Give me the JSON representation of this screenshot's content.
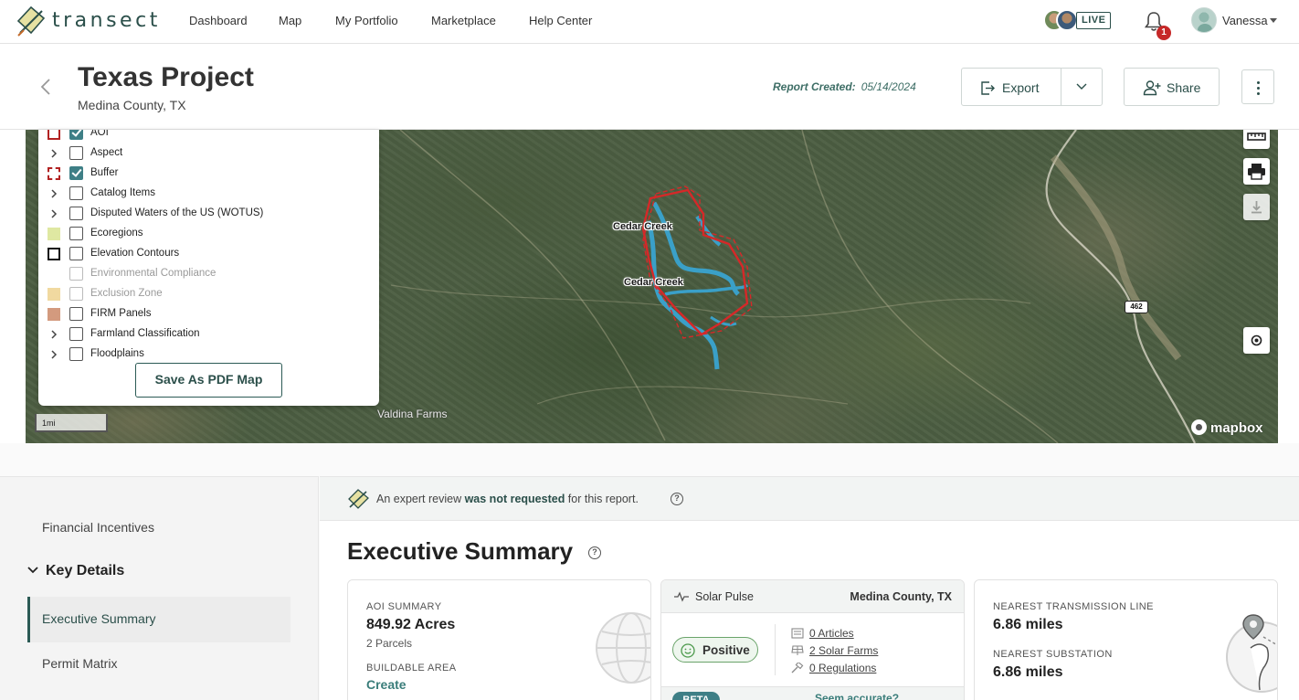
{
  "nav": {
    "brand": "transect",
    "links": [
      "Dashboard",
      "Map",
      "My Portfolio",
      "Marketplace",
      "Help Center"
    ],
    "live_label": "LIVE",
    "notification_count": "1",
    "user_name": "Vanessa"
  },
  "header": {
    "title": "Texas Project",
    "subtitle": "Medina County, TX",
    "report_created_label": "Report Created:",
    "report_created_date": "05/14/2024",
    "export_label": "Export",
    "share_label": "Share"
  },
  "layers": {
    "items": [
      {
        "label": "AOI",
        "checked": true,
        "marker": "aoi-swatch"
      },
      {
        "label": "Aspect",
        "checked": false,
        "marker": "chevron"
      },
      {
        "label": "Buffer",
        "checked": true,
        "marker": "buffer-swatch"
      },
      {
        "label": "Catalog Items",
        "checked": false,
        "marker": "chevron"
      },
      {
        "label": "Disputed Waters of the US (WOTUS)",
        "checked": false,
        "marker": "chevron"
      },
      {
        "label": "Ecoregions",
        "checked": false,
        "marker": "ecoregion-swatch"
      },
      {
        "label": "Elevation Contours",
        "checked": false,
        "marker": "contour-swatch"
      },
      {
        "label": "Environmental Compliance",
        "checked": false,
        "marker": "none",
        "disabled": true
      },
      {
        "label": "Exclusion Zone",
        "checked": false,
        "marker": "exclusion-swatch",
        "disabled": true
      },
      {
        "label": "FIRM Panels",
        "checked": false,
        "marker": "firm-swatch"
      },
      {
        "label": "Farmland Classification",
        "checked": false,
        "marker": "chevron"
      },
      {
        "label": "Floodplains",
        "checked": false,
        "marker": "chevron"
      }
    ],
    "save_pdf_label": "Save As PDF Map"
  },
  "map": {
    "labels": [
      "Cedar Creek",
      "Cedar Creek"
    ],
    "place": "Valdina Farms",
    "road_shield": "462",
    "scale": "1mi",
    "attribution": "mapbox",
    "colors": {
      "aoi": "#d62828",
      "water": "#3aa0c8"
    }
  },
  "sidebar": {
    "items": [
      "Financial Incentives",
      "Executive Summary",
      "Permit Matrix"
    ],
    "section": "Key Details"
  },
  "main": {
    "expert_pre": "An expert review ",
    "expert_bold": "was not requested",
    "expert_post": " for this report.",
    "title": "Executive Summary",
    "aoi_card": {
      "caption": "AOI SUMMARY",
      "acres": "849.92 Acres",
      "parcels": "2 Parcels",
      "buildable_caption": "BUILDABLE AREA",
      "buildable_link": "Create"
    },
    "solar_card": {
      "title": "Solar Pulse",
      "county": "Medina County, TX",
      "sentiment": "Positive",
      "articles": "0 Articles",
      "solar_farms": "2 Solar Farms",
      "regulations": "0 Regulations",
      "beta": "BETA",
      "accurate": "Seem accurate?"
    },
    "transmission_card": {
      "line_caption": "NEAREST TRANSMISSION LINE",
      "line_value": "6.86 miles",
      "sub_caption": "NEAREST SUBSTATION",
      "sub_value": "6.86 miles"
    }
  }
}
